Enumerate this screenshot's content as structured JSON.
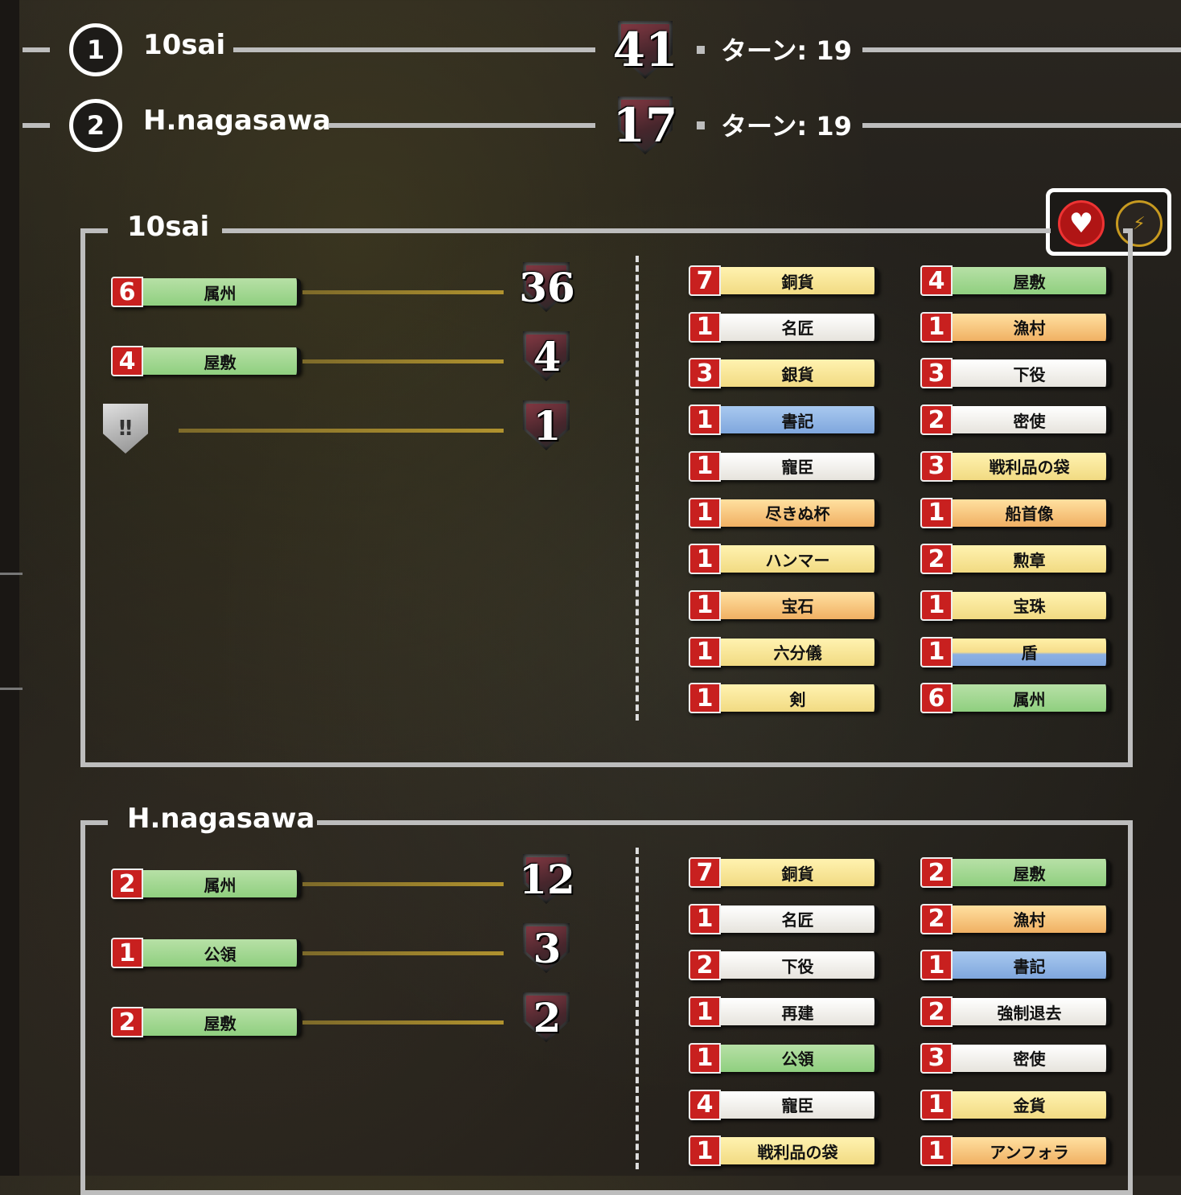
{
  "ranking": [
    {
      "rank": "1",
      "name": "10sai",
      "score": "41",
      "turn": "ターン: 19"
    },
    {
      "rank": "2",
      "name": "H.nagasawa",
      "score": "17",
      "turn": "ターン: 19"
    }
  ],
  "players": [
    {
      "name": "10sai",
      "summary": [
        {
          "count": "6",
          "label": "属州",
          "color": "green",
          "points": "36"
        },
        {
          "count": "4",
          "label": "屋敷",
          "color": "green",
          "points": "4"
        },
        {
          "icon": "bonus-shield-icon",
          "points": "1"
        }
      ],
      "cards_left": [
        {
          "count": "7",
          "label": "銅貨",
          "color": "yellow"
        },
        {
          "count": "1",
          "label": "名匠",
          "color": "white"
        },
        {
          "count": "3",
          "label": "銀貨",
          "color": "yellow"
        },
        {
          "count": "1",
          "label": "書記",
          "color": "blue"
        },
        {
          "count": "1",
          "label": "寵臣",
          "color": "white"
        },
        {
          "count": "1",
          "label": "尽きぬ杯",
          "color": "orange"
        },
        {
          "count": "1",
          "label": "ハンマー",
          "color": "yellow"
        },
        {
          "count": "1",
          "label": "宝石",
          "color": "orange"
        },
        {
          "count": "1",
          "label": "六分儀",
          "color": "yellow"
        },
        {
          "count": "1",
          "label": "剣",
          "color": "yellow"
        }
      ],
      "cards_right": [
        {
          "count": "4",
          "label": "屋敷",
          "color": "green"
        },
        {
          "count": "1",
          "label": "漁村",
          "color": "orange"
        },
        {
          "count": "3",
          "label": "下役",
          "color": "white"
        },
        {
          "count": "2",
          "label": "密使",
          "color": "white"
        },
        {
          "count": "3",
          "label": "戦利品の袋",
          "color": "yellow"
        },
        {
          "count": "1",
          "label": "船首像",
          "color": "orange"
        },
        {
          "count": "2",
          "label": "勲章",
          "color": "yellow"
        },
        {
          "count": "1",
          "label": "宝珠",
          "color": "yellow"
        },
        {
          "count": "1",
          "label": "盾",
          "color": "blueyellow"
        },
        {
          "count": "6",
          "label": "属州",
          "color": "green"
        }
      ]
    },
    {
      "name": "H.nagasawa",
      "summary": [
        {
          "count": "2",
          "label": "属州",
          "color": "green",
          "points": "12"
        },
        {
          "count": "1",
          "label": "公領",
          "color": "green",
          "points": "3"
        },
        {
          "count": "2",
          "label": "屋敷",
          "color": "green",
          "points": "2"
        }
      ],
      "cards_left": [
        {
          "count": "7",
          "label": "銅貨",
          "color": "yellow"
        },
        {
          "count": "1",
          "label": "名匠",
          "color": "white"
        },
        {
          "count": "2",
          "label": "下役",
          "color": "white"
        },
        {
          "count": "1",
          "label": "再建",
          "color": "white"
        },
        {
          "count": "1",
          "label": "公領",
          "color": "green"
        },
        {
          "count": "4",
          "label": "寵臣",
          "color": "white"
        },
        {
          "count": "1",
          "label": "戦利品の袋",
          "color": "yellow"
        }
      ],
      "cards_right": [
        {
          "count": "2",
          "label": "屋敷",
          "color": "green"
        },
        {
          "count": "2",
          "label": "漁村",
          "color": "orange"
        },
        {
          "count": "1",
          "label": "書記",
          "color": "blue"
        },
        {
          "count": "2",
          "label": "強制退去",
          "color": "white"
        },
        {
          "count": "3",
          "label": "密使",
          "color": "white"
        },
        {
          "count": "1",
          "label": "金貨",
          "color": "yellow"
        },
        {
          "count": "1",
          "label": "アンフォラ",
          "color": "orange"
        }
      ]
    }
  ],
  "controls": {
    "heart_icon": "heart-icon",
    "bolt_icon": "lightning-icon"
  }
}
